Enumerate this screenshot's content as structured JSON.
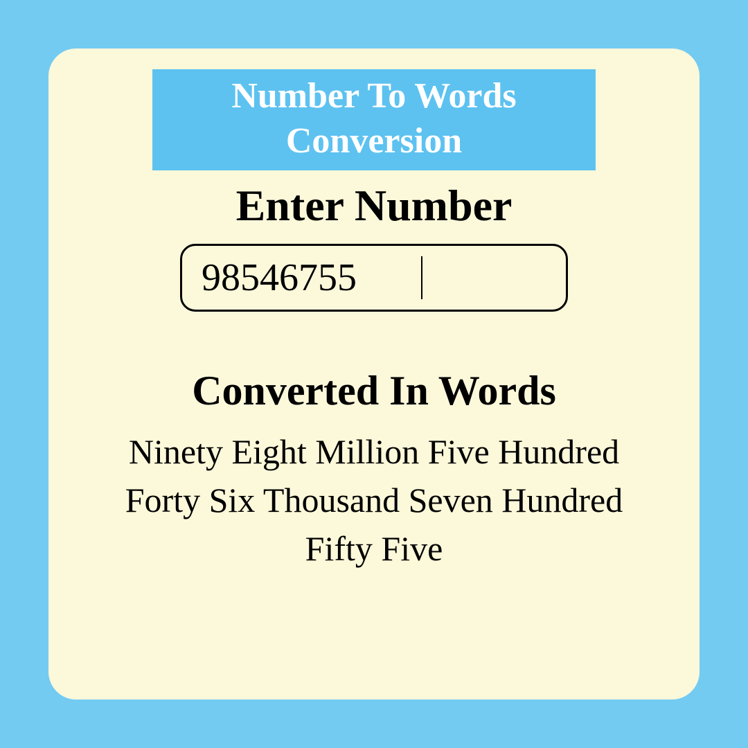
{
  "header": {
    "title": "Number To Words Conversion"
  },
  "input": {
    "label": "Enter Number",
    "value": "98546755"
  },
  "output": {
    "label": "Converted In Words",
    "words": "Ninety Eight Million Five Hundred Forty Six Thousand Seven Hundred Fifty Five"
  },
  "colors": {
    "page_bg": "#73CBF2",
    "card_bg": "#FCF8DA",
    "title_bg": "#5DC2F0"
  }
}
